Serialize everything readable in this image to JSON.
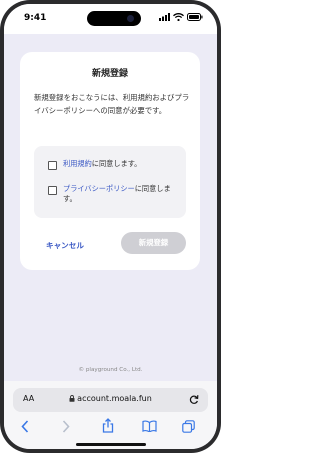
{
  "status_bar": {
    "time": "9:41"
  },
  "modal": {
    "title": "新規登録",
    "body": "新規登録をおこなうには、利用規約およびプライバシーポリシーへの同意が必要です。",
    "consents": [
      {
        "link": "利用規約",
        "suffix": "に同意します。"
      },
      {
        "link": "プライバシーポリシー",
        "suffix": "に同意します。"
      }
    ],
    "cancel_label": "キャンセル",
    "submit_label": "新規登録"
  },
  "footer": {
    "copyright": "© playground Co., Ltd."
  },
  "browser": {
    "text_size_label": "AA",
    "url": "account.moala.fun"
  },
  "colors": {
    "accent": "#3a58c4",
    "page_background": "#ecebf6",
    "disabled_button": "#cfcfd4"
  }
}
